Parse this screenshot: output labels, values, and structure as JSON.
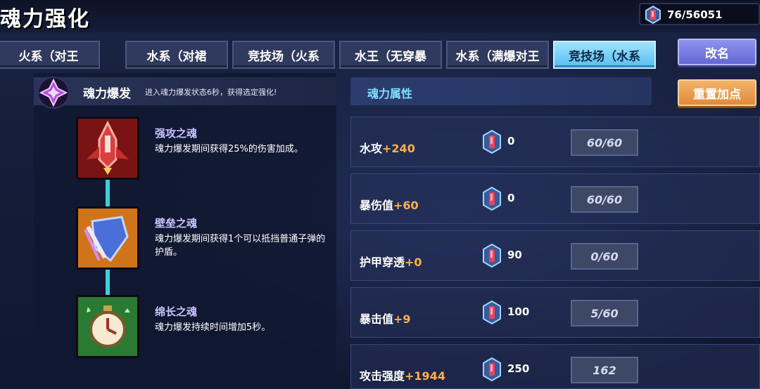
{
  "header": {
    "title": "魂力强化",
    "currency_value": "76/56051"
  },
  "tabs": [
    {
      "label": "火系（对王",
      "active": false
    },
    {
      "label": "水系（对裙",
      "active": false
    },
    {
      "label": "竞技场（火系",
      "active": false
    },
    {
      "label": "水王（无穿暴",
      "active": false
    },
    {
      "label": "水系（满爆对王",
      "active": false
    },
    {
      "label": "竞技场（水系",
      "active": true
    }
  ],
  "rename_label": "改名",
  "burst": {
    "title": "魂力爆发",
    "description": "进入魂力爆发状态6秒，获得选定强化!"
  },
  "souls": [
    {
      "name": "强攻之魂",
      "description": "魂力爆发期间获得25%的伤害加成。",
      "icon": "rocket-icon"
    },
    {
      "name": "壁垒之魂",
      "description": "魂力爆发期间获得1个可以抵挡普通子弹的护盾。",
      "icon": "shield-icon"
    },
    {
      "name": "绵长之魂",
      "description": "魂力爆发持续时间增加5秒。",
      "icon": "stopwatch-icon"
    }
  ],
  "attributes_header": "魂力属性",
  "reset_label": "重置加点",
  "attributes": [
    {
      "name": "水攻",
      "bonus": "+240",
      "cost": "0",
      "level": "60/60"
    },
    {
      "name": "暴伤值",
      "bonus": "+60",
      "cost": "0",
      "level": "60/60"
    },
    {
      "name": "护甲穿透",
      "bonus": "+0",
      "cost": "90",
      "level": "0/60"
    },
    {
      "name": "暴击值",
      "bonus": "+9",
      "cost": "100",
      "level": "5/60"
    },
    {
      "name": "攻击强度",
      "bonus": "+1944",
      "cost": "250",
      "level": "162"
    }
  ],
  "colors": {
    "active_tab": "#58bdf0",
    "bonus": "#ffb04a",
    "attr_header_text": "#7fe0ff",
    "rename_button": "#6468d4",
    "reset_button": "#e08a3a"
  }
}
